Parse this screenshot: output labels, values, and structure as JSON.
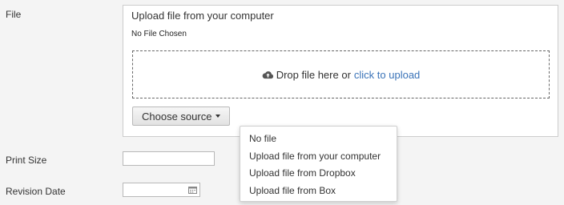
{
  "form": {
    "file_label": "File",
    "print_size_label": "Print Size",
    "revision_date_label": "Revision Date"
  },
  "upload": {
    "title": "Upload file from your computer",
    "status": "No File Chosen",
    "drop_text": "Drop file here or",
    "drop_link": "click to upload",
    "choose_source": "Choose source"
  },
  "source_menu": {
    "items": [
      {
        "label": "No file"
      },
      {
        "label": "Upload file from your computer"
      },
      {
        "label": "Upload file from Dropbox"
      },
      {
        "label": "Upload file from Box"
      }
    ]
  },
  "inputs": {
    "print_size_value": "",
    "revision_date_value": ""
  },
  "icons": {
    "cloud": "cloud-upload-icon",
    "calendar": "calendar-icon",
    "caret": "caret-down-icon"
  },
  "colors": {
    "link": "#3a73b8",
    "panel_border": "#cccccc",
    "background": "#f4f4f4"
  }
}
